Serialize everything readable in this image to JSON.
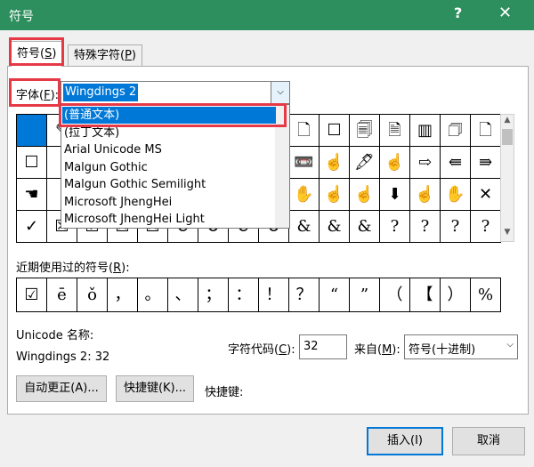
{
  "window": {
    "title": "符号",
    "help": "?",
    "close": "✕"
  },
  "tabs": [
    {
      "label": "符号(",
      "key": "S",
      "suffix": ")"
    },
    {
      "label": "特殊字符(",
      "key": "P",
      "suffix": ")"
    }
  ],
  "font": {
    "label": "字体(",
    "key": "F",
    "suffix": "):",
    "value": "Wingdings 2",
    "arrow": "⌵"
  },
  "font_dropdown": {
    "items": [
      "(普通文本)",
      "(拉丁文本)",
      "Arial Unicode MS",
      "Malgun Gothic",
      "Malgun Gothic Semilight",
      "Microsoft JhengHei",
      "Microsoft JhengHei Light"
    ],
    "highlighted_index": 0
  },
  "symbol_grid": {
    "rows": [
      [
        "",
        "✎",
        "",
        "",
        "",
        "",
        "",
        "",
        "",
        "🗋",
        "☐",
        "🗐",
        "🗎",
        "▥",
        "🗇",
        "🗋"
      ],
      [
        "☐",
        "",
        "",
        "",
        "",
        "",
        "",
        "",
        "",
        "📼",
        "☝",
        "🖋",
        "☝",
        "⇨",
        "⇚",
        "⇛"
      ],
      [
        "☚",
        "",
        "",
        "",
        "",
        "",
        "",
        "",
        "",
        "✋",
        "☝",
        "☝",
        "⬇",
        "☝",
        "✋",
        "✕"
      ],
      [
        "✓",
        "☒",
        "☑",
        "☒",
        "☒",
        "⊘",
        "⊗",
        "⊘",
        "⊗",
        "&",
        "&",
        "&",
        "?",
        "?",
        "?",
        "?"
      ]
    ]
  },
  "recent": {
    "label": "近期使用过的符号(",
    "key": "R",
    "suffix": "):",
    "symbols": [
      "☑",
      "ē",
      "ǒ",
      "，",
      "。",
      "、",
      "；",
      "：",
      "！",
      "？",
      "“",
      "”",
      "（",
      "【",
      "）",
      "%"
    ]
  },
  "unicode_name": {
    "label": "Unicode 名称:",
    "value": "Wingdings 2: 32"
  },
  "char_code": {
    "label": "字符代码(",
    "key": "C",
    "suffix": "):",
    "value": "32"
  },
  "from": {
    "label": "来自(",
    "key": "M",
    "suffix": "):",
    "value": "符号(十进制)",
    "arrow": "⌵"
  },
  "buttons": {
    "autocorrect": "自动更正(A)...",
    "shortcut_key": "快捷键(K)...",
    "shortcut_label": "快捷键:",
    "insert": "插入(I)",
    "cancel": "取消"
  },
  "colors": {
    "title_bar": "#2d8f5e",
    "highlight": "#0078d7",
    "annotation_red": "#e63946"
  }
}
